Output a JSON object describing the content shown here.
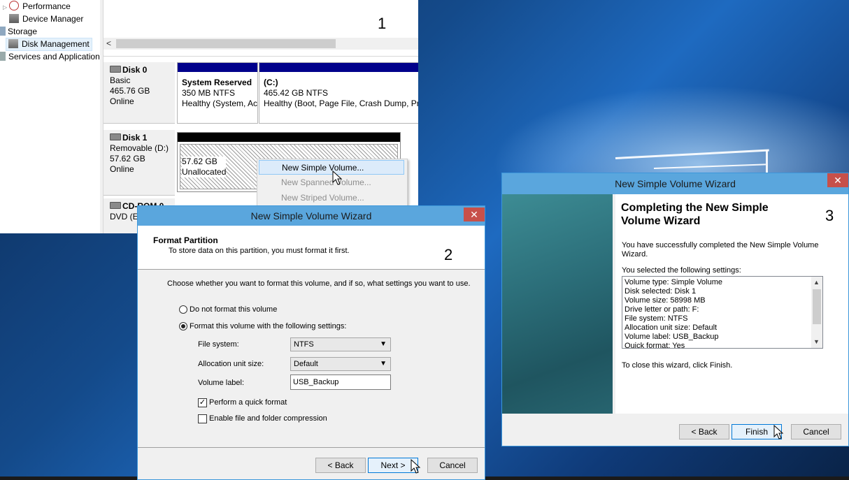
{
  "tree": {
    "items": [
      {
        "label": "Performance"
      },
      {
        "label": "Device Manager"
      },
      {
        "label": "Storage"
      },
      {
        "label": "Disk Management"
      },
      {
        "label": "Services and Applications"
      }
    ]
  },
  "step_numbers": {
    "one": "1",
    "two": "2",
    "three": "3"
  },
  "disks": [
    {
      "name": "Disk 0",
      "type": "Basic",
      "size": "465.76 GB",
      "status": "Online"
    },
    {
      "name": "Disk 1",
      "type": "Removable (D:)",
      "size": "57.62 GB",
      "status": "Online"
    },
    {
      "name": "CD-ROM 0",
      "type": "DVD (E:)"
    }
  ],
  "partitions": {
    "system_reserved": {
      "title": "System Reserved",
      "fs": "350 MB NTFS",
      "health": "Healthy (System, Active, Primary Partition)"
    },
    "c_drive": {
      "title": "(C:)",
      "fs": "465.42 GB NTFS",
      "health": "Healthy (Boot, Page File, Crash Dump, Primary Partition)"
    },
    "unallocated": {
      "size": "57.62 GB",
      "label": "Unallocated"
    }
  },
  "context_menu": {
    "items": [
      {
        "label": "New Simple Volume..."
      },
      {
        "label": "New Spanned Volume..."
      },
      {
        "label": "New Striped Volume..."
      }
    ]
  },
  "wizard2": {
    "title": "New Simple Volume Wizard",
    "close": "✕",
    "header_title": "Format Partition",
    "header_sub": "To store data on this partition, you must format it first.",
    "prompt": "Choose whether you want to format this volume, and if so, what settings you want to use.",
    "radio_no_format": "Do not format this volume",
    "radio_format": "Format this volume with the following settings:",
    "fs_label": "File system:",
    "fs_value": "NTFS",
    "alloc_label": "Allocation unit size:",
    "alloc_value": "Default",
    "vol_label": "Volume label:",
    "vol_value": "USB_Backup",
    "quick_format": "Perform a quick format",
    "compression": "Enable file and folder compression",
    "back": "< Back",
    "next": "Next >",
    "cancel": "Cancel"
  },
  "wizard3": {
    "title": "New Simple Volume Wizard",
    "close": "✕",
    "heading": "Completing the New Simple Volume Wizard",
    "success": "You have successfully completed the New Simple Volume Wizard.",
    "selected": "You selected the following settings:",
    "settings": [
      "Volume type: Simple Volume",
      "Disk selected: Disk 1",
      "Volume size: 58998 MB",
      "Drive letter or path: F:",
      "File system: NTFS",
      "Allocation unit size: Default",
      "Volume label: USB_Backup",
      "Quick format: Yes"
    ],
    "close_hint": "To close this wizard, click Finish.",
    "back": "< Back",
    "finish": "Finish",
    "cancel": "Cancel"
  },
  "colors": {
    "accent": "#5aa6dd",
    "close": "#c7504a",
    "disk_bar": "#00008b"
  }
}
